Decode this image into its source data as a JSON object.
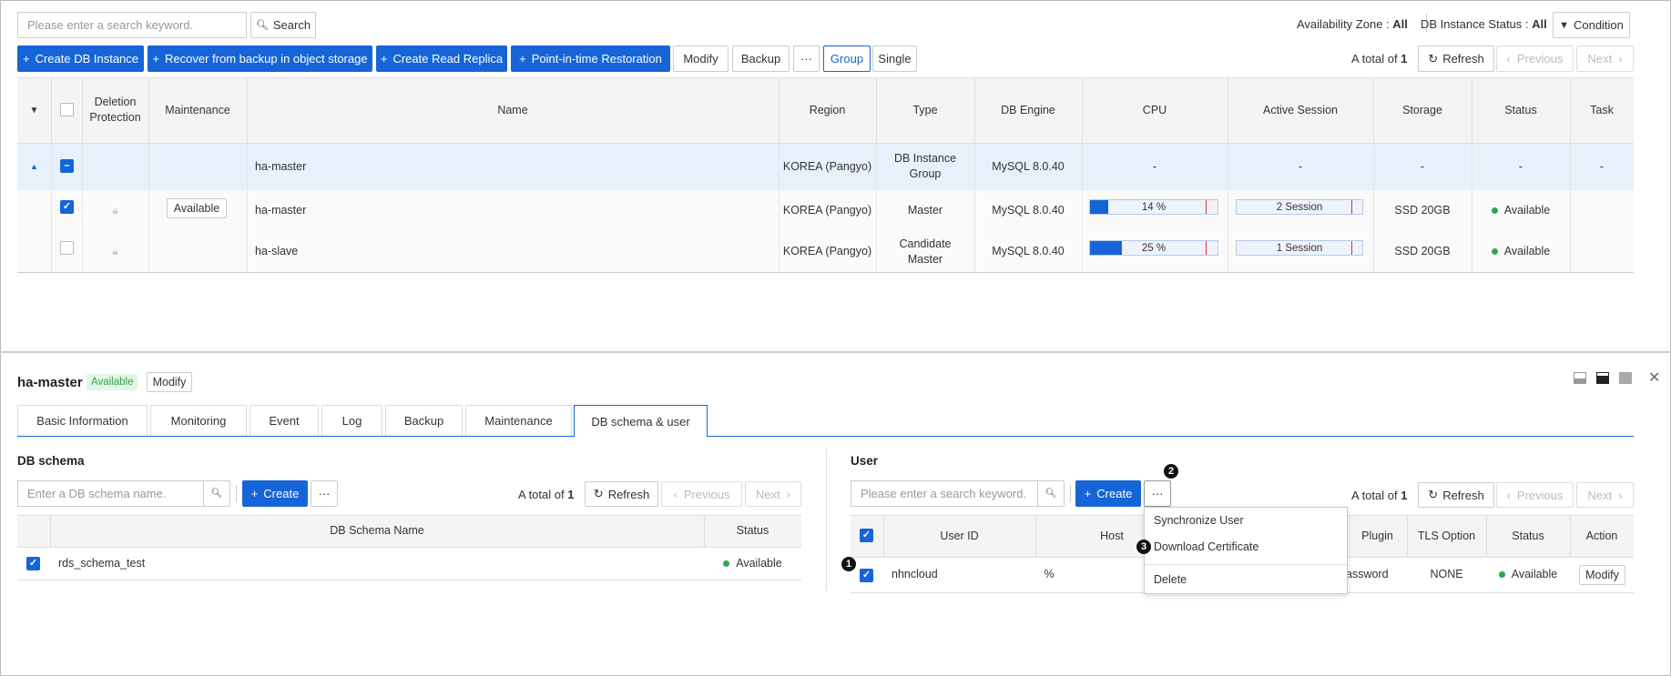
{
  "toolbar": {
    "search_placeholder": "Please enter a search keyword.",
    "search_label": "Search",
    "az_label": "Availability Zone",
    "az_value": "All",
    "status_label": "DB Instance Status",
    "status_value": "All",
    "condition_label": "Condition",
    "create_label": "Create DB Instance",
    "recover_label": "Recover from backup in object storage",
    "replica_label": "Create Read Replica",
    "pitr_label": "Point-in-time Restoration",
    "modify_label": "Modify",
    "backup_label": "Backup",
    "more_label": "···",
    "group_label": "Group",
    "single_label": "Single",
    "total_prefix": "A total of",
    "total_count": "1",
    "refresh_label": "Refresh",
    "prev_label": "Previous",
    "next_label": "Next"
  },
  "grid": {
    "headers": {
      "deletion": "Deletion Protection",
      "maintenance": "Maintenance",
      "name": "Name",
      "region": "Region",
      "type": "Type",
      "engine": "DB Engine",
      "cpu": "CPU",
      "session": "Active Session",
      "storage": "Storage",
      "status": "Status",
      "task": "Task"
    },
    "group_row": {
      "name": "ha-master",
      "region": "KOREA (Pangyo)",
      "type": "DB Instance Group",
      "engine": "MySQL 8.0.40",
      "cpu": "-",
      "session": "-",
      "storage": "-",
      "status": "-",
      "task": "-"
    },
    "rows": [
      {
        "maintenance": "Available",
        "name": "ha-master",
        "region": "KOREA (Pangyo)",
        "type": "Master",
        "engine": "MySQL 8.0.40",
        "cpu_pct": 14,
        "cpu_text": "14 %",
        "session_text": "2 Session",
        "storage": "SSD 20GB",
        "status": "Available",
        "checked": true
      },
      {
        "maintenance": "",
        "name": "ha-slave",
        "region": "KOREA (Pangyo)",
        "type": "Candidate Master",
        "engine": "MySQL 8.0.40",
        "cpu_pct": 25,
        "cpu_text": "25 %",
        "session_text": "1 Session",
        "storage": "SSD 20GB",
        "status": "Available",
        "checked": false
      }
    ]
  },
  "detail": {
    "title": "ha-master",
    "status_badge": "Available",
    "modify_label": "Modify",
    "tabs": [
      "Basic Information",
      "Monitoring",
      "Event",
      "Log",
      "Backup",
      "Maintenance",
      "DB schema & user"
    ],
    "active_tab": "DB schema & user"
  },
  "schema": {
    "section_title": "DB schema",
    "search_placeholder": "Enter a DB schema name.",
    "create_label": "Create",
    "more_label": "···",
    "total_prefix": "A total of",
    "total_count": "1",
    "refresh_label": "Refresh",
    "prev_label": "Previous",
    "next_label": "Next",
    "col_name": "DB Schema Name",
    "col_status": "Status",
    "rows": [
      {
        "name": "rds_schema_test",
        "status": "Available"
      }
    ]
  },
  "user": {
    "section_title": "User",
    "search_placeholder": "Please enter a search keyword.",
    "create_label": "Create",
    "more_label": "···",
    "total_prefix": "A total of",
    "total_count": "1",
    "refresh_label": "Refresh",
    "prev_label": "Previous",
    "next_label": "Next",
    "col_userid": "User ID",
    "col_host": "Host",
    "col_plugin": "Plugin",
    "col_tls": "TLS Option",
    "col_status": "Status",
    "col_action": "Action",
    "rows": [
      {
        "user_id": "nhncloud",
        "host": "%",
        "plugin": "assword",
        "tls": "NONE",
        "status": "Available",
        "action": "Modify"
      }
    ],
    "menu": [
      "Synchronize User",
      "Download Certificate",
      "Delete"
    ]
  },
  "callouts": [
    "1",
    "2",
    "3"
  ],
  "colors": {
    "primary": "#1565d8",
    "available": "#2ea74a",
    "row_highlight": "#e8f0fb"
  }
}
